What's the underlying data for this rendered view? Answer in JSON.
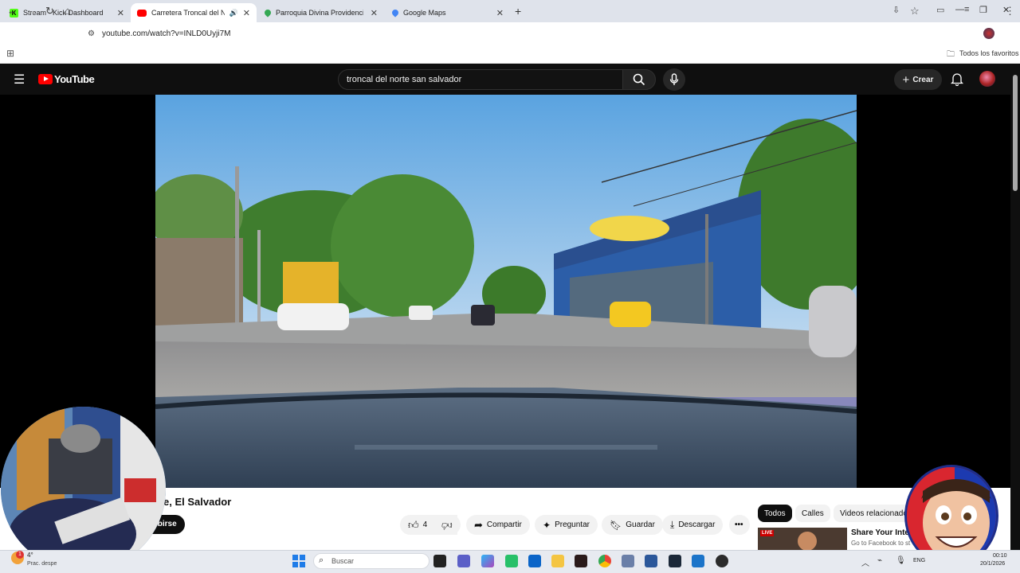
{
  "browser": {
    "tabs": [
      {
        "label": "Stream - Kick Dashboard",
        "favicon": "kick-icon"
      },
      {
        "label": "Carretera Troncal del Norte",
        "favicon": "youtube-icon",
        "active": true
      },
      {
        "label": "Parroquia Divina Providencia - ",
        "favicon": "maps-pin-icon"
      },
      {
        "label": "Google Maps",
        "favicon": "maps-pin-icon"
      }
    ],
    "url": "youtube.com/watch?v=INLD0Uyji7M",
    "bookmarks_label": "Todos los favoritos"
  },
  "youtube": {
    "logo_text": "YouTube",
    "search_value": "troncal del norte san salvador",
    "create_label": "Crear",
    "video_title": "e, El Salvador",
    "subscribe_label": "ibirse",
    "like_count": "4",
    "share_label": "Compartir",
    "ask_label": "Preguntar",
    "save_label": "Guardar",
    "download_label": "Descargar",
    "chips": [
      "Todos",
      "Calles",
      "Videos relacionado"
    ],
    "rec_title": "Share Your Inter",
    "rec_sub": "Go to Facebook to st",
    "rec_badge": "LIVE"
  },
  "taskbar": {
    "search_placeholder": "Buscar",
    "weather_temp": "4°",
    "weather_sub": "Prac. despe",
    "lang": "ENG",
    "time": "00:10",
    "date": "20/1/2026",
    "notif_count": "1"
  },
  "colors": {
    "yt_red": "#ff0000",
    "kick_green": "#53fc18",
    "tab_strip": "#dfe3eb"
  }
}
